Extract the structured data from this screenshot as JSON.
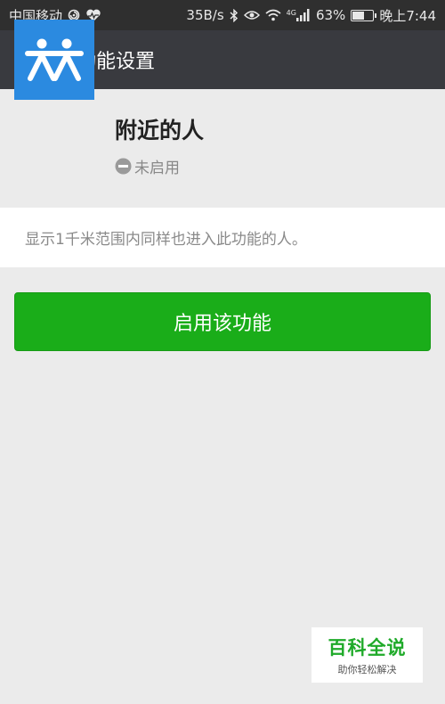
{
  "status_bar": {
    "carrier": "中国移动",
    "speed": "35B/s",
    "network": "4G",
    "battery": "63%",
    "battery_level": 0.63,
    "time": "晚上7:44"
  },
  "app_bar": {
    "title": "功能设置"
  },
  "feature": {
    "name": "附近的人",
    "status": "未启用",
    "description": "显示1千米范围内同样也进入此功能的人。"
  },
  "actions": {
    "enable_label": "启用该功能"
  },
  "watermark": {
    "title": "百科全说",
    "subtitle": "助你轻松解决"
  },
  "colors": {
    "status_bar_bg": "#2f2f2f",
    "app_bar_bg": "#393a3f",
    "icon_bg": "#2b8ae0",
    "button_green": "#1aad19",
    "page_bg": "#ebebeb"
  }
}
